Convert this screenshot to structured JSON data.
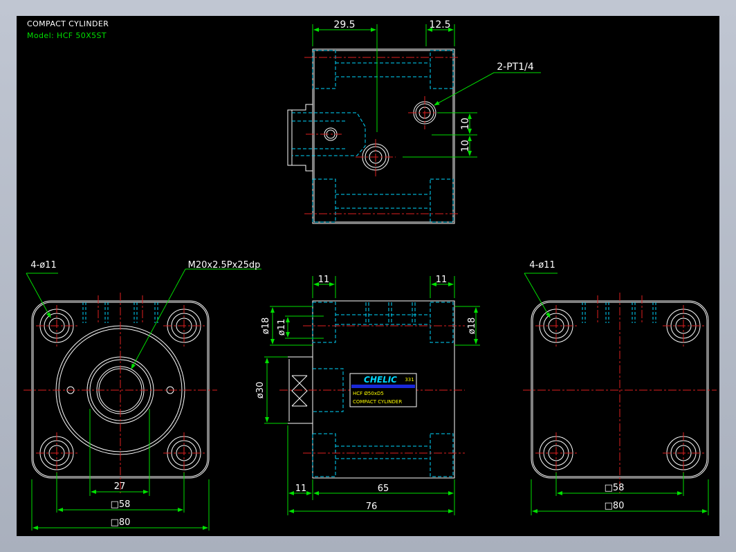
{
  "drawing": {
    "title": "COMPACT CYLINDER",
    "model": "Model:  HCF  50X5ST",
    "colors": {
      "background": "#000000",
      "outline": "#ffffff",
      "hidden": "#00d8ff",
      "center": "#e02020",
      "dimension": "#00e000",
      "text": "#ffffff",
      "label_text": "#ffff00",
      "label_band": "#1a28d8"
    }
  },
  "top_view": {
    "dims": {
      "left": "29.5",
      "right": "12.5",
      "v_upper": "10",
      "v_lower": "10"
    },
    "port_callout": "2-PT1/4"
  },
  "front_view": {
    "hole_callout": "4-ø11",
    "thread_callout": "M20x2.5Px25dp",
    "dims": {
      "bore": "27",
      "bolt_square": "□58",
      "body_square": "□80"
    }
  },
  "side_view": {
    "dims": {
      "top_left": "11",
      "top_right": "11",
      "d18_left": "ø18",
      "d11": "ø11",
      "d18_right": "ø18",
      "d30": "ø30",
      "rod_len": "11",
      "body_len": "65",
      "total_len": "76"
    },
    "nameplate": {
      "brand": "CHELIC",
      "code": "331",
      "model": "HCF Ø50xD5",
      "name": "COMPACT CYLINDER"
    }
  },
  "rear_view": {
    "hole_callout": "4-ø11",
    "dims": {
      "bolt_square": "□58",
      "body_square": "□80"
    }
  }
}
